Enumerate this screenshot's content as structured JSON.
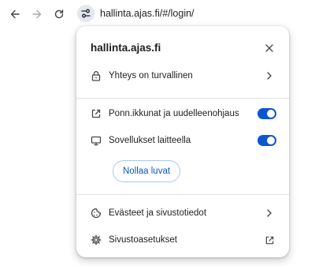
{
  "toolbar": {
    "url": "hallinta.ajas.fi/#/login/",
    "back_icon": "arrow-left-icon",
    "forward_icon": "arrow-right-icon",
    "reload_icon": "reload-icon",
    "site_info_icon": "tune-icon"
  },
  "popup": {
    "title": "hallinta.ajas.fi",
    "connection": {
      "label": "Yhteys on turvallinen",
      "icon": "lock-icon"
    },
    "permissions": [
      {
        "label": "Ponn.ikkunat ja uudelleenohjaus",
        "icon": "open-in-new-icon",
        "enabled": true
      },
      {
        "label": "Sovellukset laitteella",
        "icon": "monitor-icon",
        "enabled": true
      }
    ],
    "reset_label": "Nollaa luvat",
    "cookies": {
      "label": "Evästeet ja sivustotiedot",
      "icon": "cookie-icon"
    },
    "site_settings": {
      "label": "Sivustoasetukset",
      "icon": "gear-icon"
    }
  },
  "colors": {
    "accent": "#0b57d0",
    "site_info_bg": "#e2e8f1",
    "divider": "#e3e3e3"
  }
}
